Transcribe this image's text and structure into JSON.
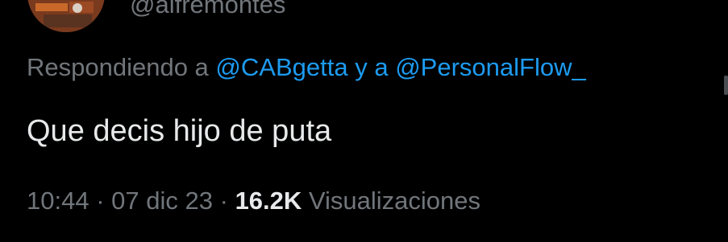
{
  "author": {
    "handle": "@alfremontes"
  },
  "reply": {
    "prefix": "Respondiendo a",
    "mention1": "@CABgetta",
    "conjunction": "y a",
    "mention2": "@PersonalFlow_"
  },
  "tweet": {
    "text": "Que decis hijo de puta"
  },
  "meta": {
    "time": "10:44",
    "sep1": "·",
    "date": "07 dic 23",
    "sep2": "·",
    "views_count": "16.2K",
    "views_label": "Visualizaciones"
  },
  "colors": {
    "background": "#000000",
    "primary_text": "#e7e9ea",
    "secondary_text": "#71767b",
    "link": "#1d9bf0"
  }
}
